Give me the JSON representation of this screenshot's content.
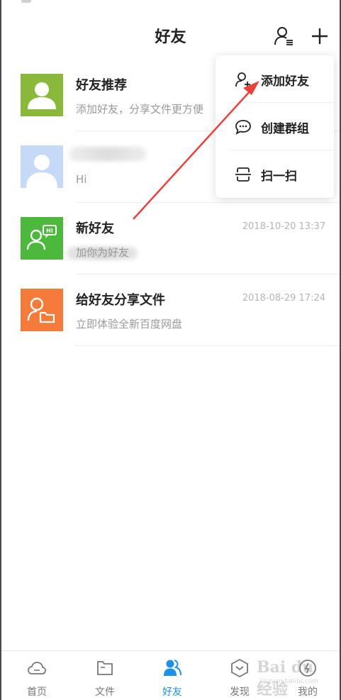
{
  "header": {
    "title": "好友"
  },
  "rows": [
    {
      "name": "好友推荐",
      "sub": "添加好友，分享文件更方便",
      "time": ""
    },
    {
      "name": "",
      "sub": "Hi",
      "time": ""
    },
    {
      "name": "新好友",
      "sub": "加你为好友",
      "time": "2018-10-20 13:37"
    },
    {
      "name": "给好友分享文件",
      "sub": "立即体验全新百度网盘",
      "time": "2018-08-29 17:24"
    }
  ],
  "menu": {
    "items": [
      {
        "label": "添加好友",
        "icon": "add-user-icon"
      },
      {
        "label": "创建群组",
        "icon": "chat-bubble-icon"
      },
      {
        "label": "扫一扫",
        "icon": "scan-icon"
      }
    ]
  },
  "tabbar": {
    "tabs": [
      {
        "label": "首页",
        "icon": "cloud-icon",
        "active": false
      },
      {
        "label": "文件",
        "icon": "folder-icon",
        "active": false
      },
      {
        "label": "好友",
        "icon": "friends-icon",
        "active": true
      },
      {
        "label": "发现",
        "icon": "discover-icon",
        "active": false
      },
      {
        "label": "我的",
        "icon": "profile-icon",
        "active": false
      }
    ]
  },
  "watermark": {
    "text": "Bai du 经验",
    "sub": "jingyan.baidu.com"
  },
  "colors": {
    "accent": "#1e90e6",
    "recommend_avatar": "#8ab83a",
    "new_friend_avatar": "#4cb83c",
    "share_avatar": "#f47b3a",
    "arrow": "#e8423f"
  }
}
